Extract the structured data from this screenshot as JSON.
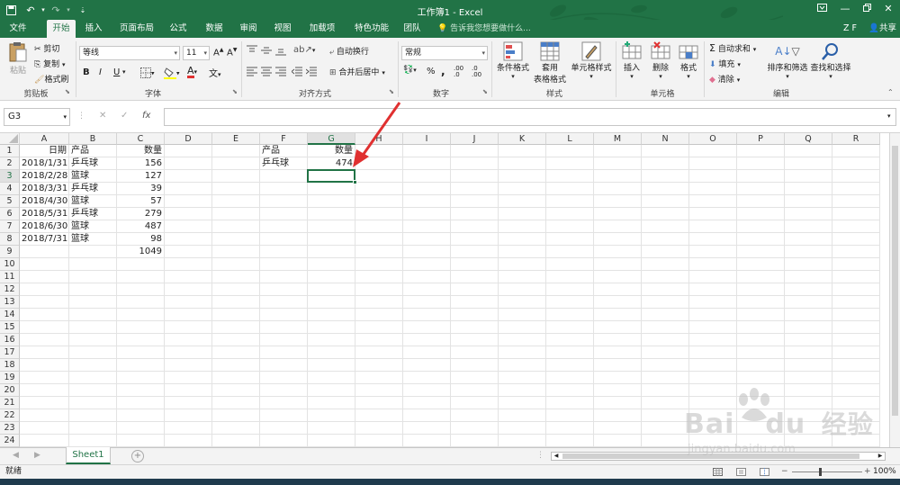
{
  "window": {
    "title": "工作簿1 - Excel",
    "min_icon": "minimize-icon",
    "restore_icon": "restore-icon",
    "close_icon": "close-icon"
  },
  "tabs": [
    "文件",
    "开始",
    "插入",
    "页面布局",
    "公式",
    "数据",
    "审阅",
    "视图",
    "加载项",
    "特色功能",
    "团队"
  ],
  "active_tab": "开始",
  "tell_me": "告诉我您想要做什么...",
  "user": "Z F",
  "share": "共享",
  "ribbon": {
    "clipboard": {
      "paste": "粘贴",
      "cut": "剪切",
      "copy": "复制",
      "format_painter": "格式刷",
      "label": "剪贴板"
    },
    "font": {
      "name": "等线",
      "size": "11",
      "label": "字体",
      "bold": "B",
      "italic": "I",
      "underline": "U"
    },
    "alignment": {
      "wrap": "自动换行",
      "merge": "合并后居中",
      "label": "对齐方式"
    },
    "number": {
      "format": "常规",
      "label": "数字",
      "percent": "%",
      "comma": ",",
      "dec_inc": ".00 .0",
      "dec_dec": ".0 .00"
    },
    "styles": {
      "cond": "条件格式",
      "table_line1": "套用",
      "table_line2": "表格格式",
      "cell_styles": "单元格样式",
      "label": "样式"
    },
    "cells": {
      "insert": "插入",
      "delete": "删除",
      "format": "格式",
      "label": "单元格"
    },
    "editing": {
      "autosum": "自动求和",
      "fill": "填充",
      "clear": "清除",
      "sort": "排序和筛选",
      "find": "查找和选择",
      "label": "编辑"
    }
  },
  "formula_bar": {
    "name_box": "G3",
    "fx": "fx",
    "content": ""
  },
  "columns": [
    "A",
    "B",
    "C",
    "D",
    "E",
    "F",
    "G",
    "H",
    "I",
    "J",
    "K",
    "L",
    "M",
    "N",
    "O",
    "P",
    "Q",
    "R"
  ],
  "rows": [
    "1",
    "2",
    "3",
    "4",
    "5",
    "6",
    "7",
    "8",
    "9",
    "10",
    "11",
    "12",
    "13",
    "14",
    "15",
    "16",
    "17",
    "18",
    "19",
    "20",
    "21",
    "22",
    "23",
    "24"
  ],
  "cells": {
    "A1": "日期",
    "B1": "产品",
    "C1": "数量",
    "A2": "2018/1/31",
    "B2": "乒乓球",
    "C2": "156",
    "A3": "2018/2/28",
    "B3": "篮球",
    "C3": "127",
    "A4": "2018/3/31",
    "B4": "乒乓球",
    "C4": "39",
    "A5": "2018/4/30",
    "B5": "篮球",
    "C5": "57",
    "A6": "2018/5/31",
    "B6": "乒乓球",
    "C6": "279",
    "A7": "2018/6/30",
    "B7": "篮球",
    "C7": "487",
    "A8": "2018/7/31",
    "B8": "篮球",
    "C8": "98",
    "C9": "1049",
    "F1": "产品",
    "G1": "数量",
    "F2": "乒乓球",
    "G2": "474"
  },
  "selected_cell": "G3",
  "sheets": [
    "Sheet1"
  ],
  "status": {
    "ready": "就绪",
    "zoom": "100%"
  },
  "watermark": {
    "brand": "Bai",
    "brand2": "du",
    "cn": "经验",
    "url": "jingyan.baidu.com"
  }
}
